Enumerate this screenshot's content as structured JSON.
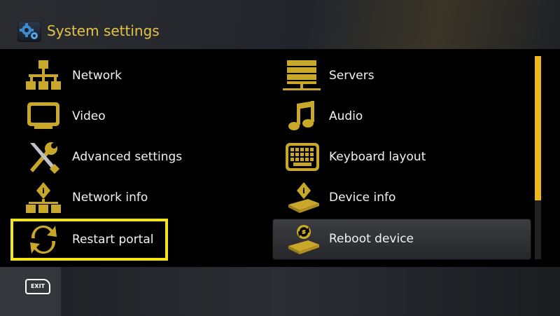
{
  "header": {
    "title": "System settings",
    "icon": "gears-icon"
  },
  "menu": {
    "left": [
      {
        "label": "Network",
        "icon": "network-icon"
      },
      {
        "label": "Video",
        "icon": "monitor-icon"
      },
      {
        "label": "Advanced settings",
        "icon": "tools-icon"
      },
      {
        "label": "Network info",
        "icon": "network-info-icon"
      },
      {
        "label": "Restart portal",
        "icon": "restart-arrows-icon",
        "state": "focused"
      }
    ],
    "right": [
      {
        "label": "Servers",
        "icon": "server-rack-icon"
      },
      {
        "label": "Audio",
        "icon": "music-note-icon"
      },
      {
        "label": "Keyboard layout",
        "icon": "keyboard-icon"
      },
      {
        "label": "Device info",
        "icon": "device-info-icon"
      },
      {
        "label": "Reboot device",
        "icon": "reboot-device-icon",
        "state": "selected"
      }
    ]
  },
  "footer": {
    "exit_label": "EXIT"
  },
  "colors": {
    "accent": "#e3c24a",
    "focus_border": "#f3e41c",
    "scroll_thumb": "#e9b81f"
  }
}
